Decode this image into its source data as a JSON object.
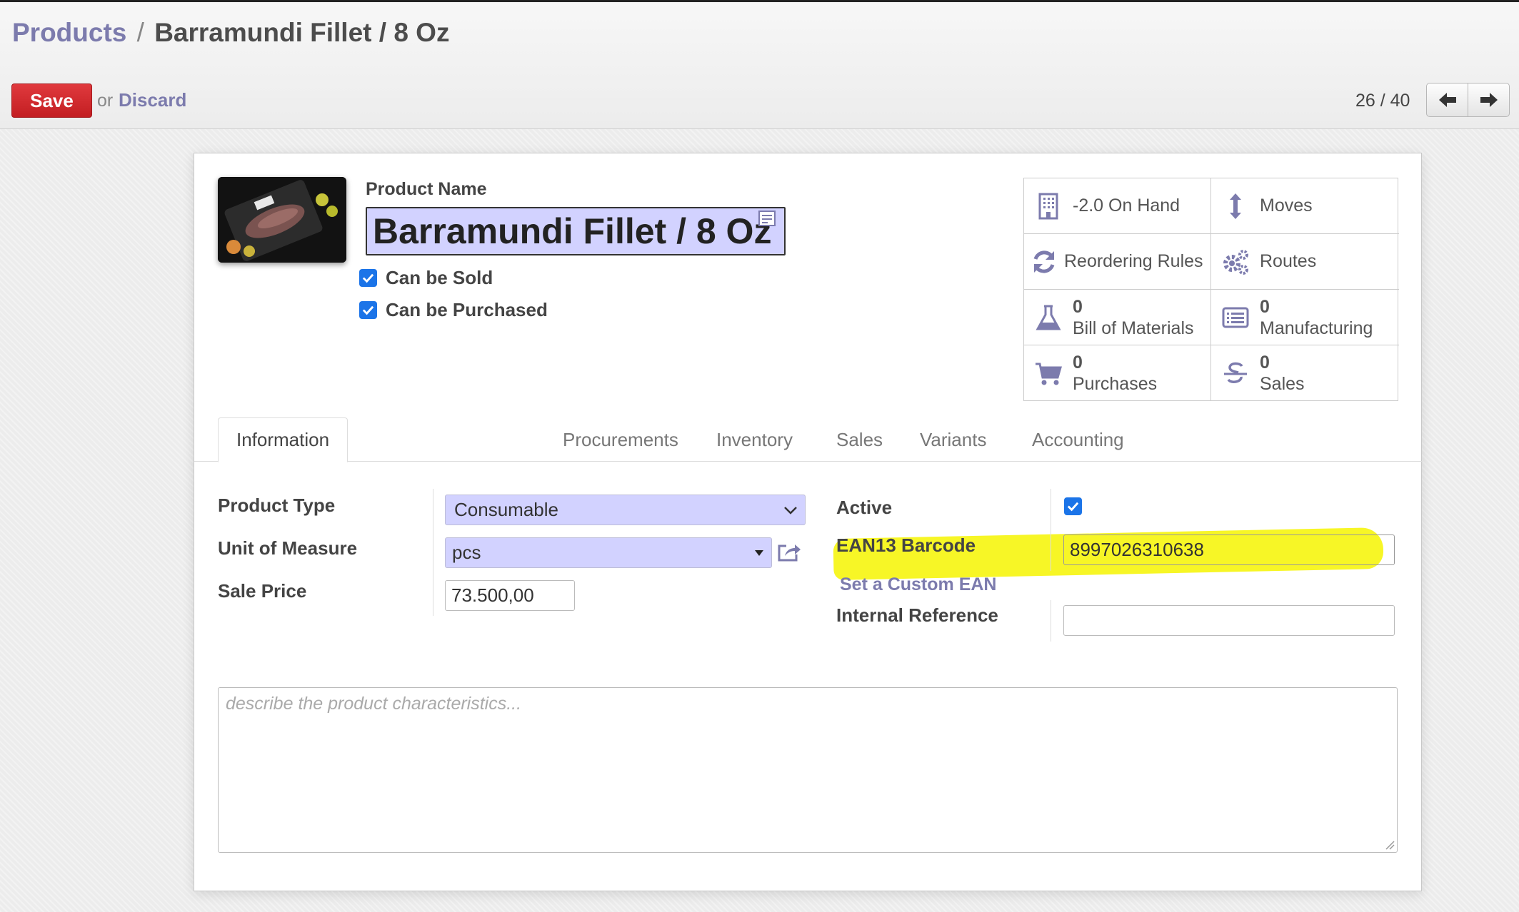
{
  "breadcrumb": {
    "root": "Products",
    "separator": "/",
    "current": "Barramundi Fillet / 8 Oz"
  },
  "actions": {
    "save_label": "Save",
    "or_text": "or",
    "discard_label": "Discard"
  },
  "pager": {
    "value": "26 / 40",
    "prev_icon": "arrow-left-icon",
    "next_icon": "arrow-right-icon"
  },
  "product": {
    "name_label": "Product Name",
    "name_value": "Barramundi Fillet / 8 Oz",
    "can_be_sold_label": "Can be Sold",
    "can_be_sold": true,
    "can_be_purchased_label": "Can be Purchased",
    "can_be_purchased": true
  },
  "stat_buttons": {
    "on_hand": {
      "label": "-2.0 On Hand",
      "icon": "building-icon"
    },
    "moves": {
      "label": "Moves",
      "icon": "arrows-v-icon"
    },
    "reordering": {
      "label": "Reordering Rules",
      "icon": "refresh-icon"
    },
    "routes": {
      "label": "Routes",
      "icon": "cogs-icon"
    },
    "bom": {
      "count": "0",
      "label": "Bill of Materials",
      "icon": "flask-icon"
    },
    "manufacturing": {
      "count": "0",
      "label": "Manufacturing",
      "icon": "list-alt-icon"
    },
    "purchases": {
      "count": "0",
      "label": "Purchases",
      "icon": "shopping-cart-icon"
    },
    "sales": {
      "count": "0",
      "label": "Sales",
      "icon": "strikethrough-s-icon"
    }
  },
  "tabs": [
    "Information",
    "Procurements",
    "Inventory",
    "Sales",
    "Variants",
    "Accounting"
  ],
  "active_tab": "Information",
  "fields": {
    "product_type_label": "Product Type",
    "product_type_value": "Consumable",
    "uom_label": "Unit of Measure",
    "uom_value": "pcs",
    "sale_price_label": "Sale Price",
    "sale_price_value": "73.500,00",
    "active_label": "Active",
    "active": true,
    "ean_label": "EAN13 Barcode",
    "ean_value": "8997026310638",
    "custom_ean_link": "Set a Custom EAN",
    "internal_ref_label": "Internal Reference",
    "internal_ref_value": ""
  },
  "description_placeholder": "describe the product characteristics...",
  "colors": {
    "primary_link": "#7c7bad",
    "save_button": "#d0292d",
    "required_field_bg": "#d2d2ff",
    "highlight": "#f6f500",
    "checkbox": "#1b74e8"
  }
}
